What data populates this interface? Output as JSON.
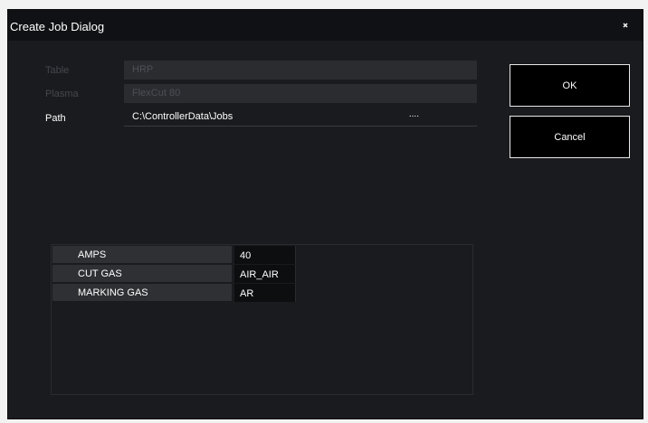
{
  "dialog": {
    "title": "Create Job Dialog",
    "close_icon": "close-icon"
  },
  "fields": {
    "table": {
      "label": "Table",
      "value": "HRP",
      "enabled": false
    },
    "plasma": {
      "label": "Plasma",
      "value": "FlexCut 80",
      "enabled": false
    },
    "path": {
      "label": "Path",
      "value": "C:\\ControllerData\\Jobs",
      "browse": "....",
      "enabled": true
    }
  },
  "buttons": {
    "ok": "OK",
    "cancel": "Cancel"
  },
  "parameters": [
    {
      "name": "AMPS",
      "value": "40"
    },
    {
      "name": "CUT GAS",
      "value": "AIR_AIR"
    },
    {
      "name": "MARKING GAS",
      "value": "AR"
    }
  ],
  "colors": {
    "dialog_background": "#1a1b1e",
    "titlebar_background": "#101114",
    "button_border": "#e8e8e8",
    "param_name_background": "#2f3034",
    "param_value_background": "#0d0e10"
  }
}
